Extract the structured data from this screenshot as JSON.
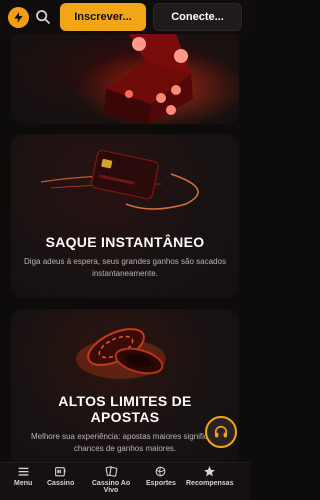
{
  "header": {
    "logo_icon": "lightning-bolt-icon",
    "search_icon": "search-icon",
    "signup_label": "Inscrever...",
    "login_label": "Conecte..."
  },
  "cards": [
    {
      "image_icon": "dice-icon",
      "title": "",
      "text": ""
    },
    {
      "image_icon": "credit-card-icon",
      "title": "SAQUE INSTANTÂNEO",
      "text": "Diga adeus à espera, seus grandes ganhos são sacados instantaneamente."
    },
    {
      "image_icon": "casino-chips-icon",
      "title_line1": "ALTOS LIMITES DE",
      "title_line2": "APOSTAS",
      "text": "Melhore sua experiência: apostas maiores significam chances de ganhos maiores."
    }
  ],
  "support_icon": "headset-icon",
  "bottom_nav": [
    {
      "label": "Menu",
      "icon": "menu-icon"
    },
    {
      "label": "Cassino",
      "icon": "slot-machine-icon"
    },
    {
      "label": "Cassino Ao Vivo",
      "icon": "cards-icon"
    },
    {
      "label": "Esportes",
      "icon": "ball-icon"
    },
    {
      "label": "Recompensas",
      "icon": "star-icon"
    }
  ],
  "colors": {
    "accent": "#f2a516",
    "background": "#0e0b0b",
    "card": "#141010"
  }
}
